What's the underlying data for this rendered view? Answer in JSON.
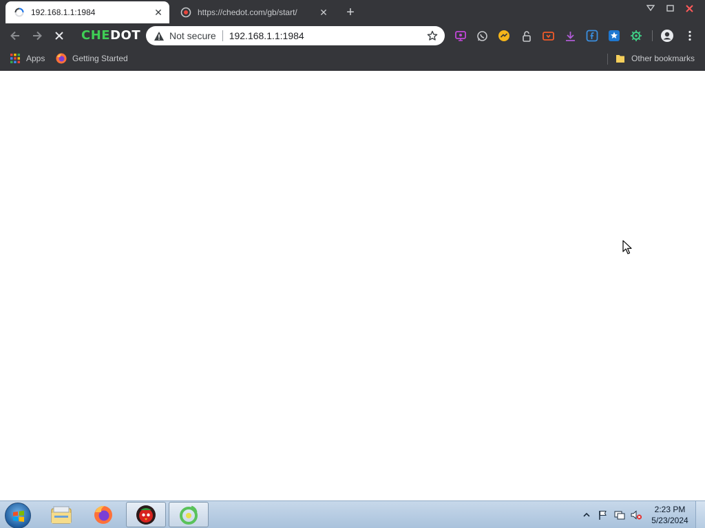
{
  "browser": {
    "logo_part1": "CHE",
    "logo_part2": "DOT",
    "tabs": [
      {
        "title": "192.168.1.1:1984",
        "state": "loading"
      },
      {
        "title": "https://chedot.com/gb/start/"
      }
    ],
    "omnibox": {
      "security_label": "Not secure",
      "url": "192.168.1.1:1984"
    },
    "extensions": [
      "screen-share-icon",
      "whatsapp-icon",
      "messenger-icon",
      "lock-icon",
      "video-download-icon",
      "download-icon",
      "facebook-icon",
      "star-badge-icon",
      "gear-extension-icon"
    ],
    "bookmarks": {
      "apps_label": "Apps",
      "getting_started_label": "Getting Started",
      "other_label": "Other bookmarks"
    }
  },
  "taskbar": {
    "clock_time": "2:23 PM",
    "clock_date": "5/23/2024",
    "pinned": [
      "explorer-icon",
      "firefox-icon",
      "angry-bird-app-icon",
      "chedot-icon"
    ]
  },
  "colors": {
    "chrome_dark": "#35363a",
    "logo_green": "#3fcf55",
    "taskbar_blue": "#b9cde3"
  }
}
